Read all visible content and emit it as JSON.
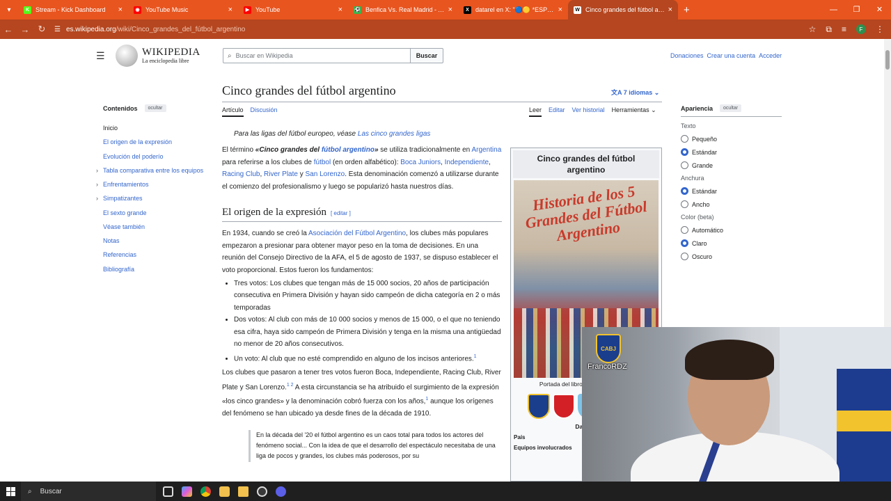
{
  "browser": {
    "tabs": [
      {
        "title": "Stream - Kick Dashboard",
        "color": "#53fc18",
        "glyph": "K"
      },
      {
        "title": "YouTube Music",
        "color": "#ff0000",
        "glyph": "◉"
      },
      {
        "title": "YouTube",
        "color": "#ff0000",
        "glyph": "▶"
      },
      {
        "title": "Benfica Vs. Real Madrid - Alinea",
        "color": "#39b54a",
        "glyph": "⚽"
      },
      {
        "title": "datarel en X: \"🔵🟡 *ESPERAN",
        "color": "#000000",
        "glyph": "X"
      },
      {
        "title": "Cinco grandes del fútbol argentin",
        "color": "#ffffff",
        "glyph": "W"
      }
    ],
    "new_tab": "+",
    "url_domain": "es.wikipedia.org",
    "url_path": "/wiki/Cinco_grandes_del_fútbol_argentino",
    "profile_initial": "F"
  },
  "wiki": {
    "logo_title": "WIKIPEDIA",
    "logo_subtitle": "La enciclopedia libre",
    "search_placeholder": "Buscar en Wikipedia",
    "search_button": "Buscar",
    "top_links": [
      "Donaciones",
      "Crear una cuenta",
      "Acceder"
    ],
    "article_title": "Cinco grandes del fútbol argentino",
    "languages": "7 idiomas",
    "tabs_left": [
      "Artículo",
      "Discusión"
    ],
    "tabs_right": [
      "Leer",
      "Editar",
      "Ver historial",
      "Herramientas"
    ],
    "toc": {
      "heading": "Contenidos",
      "hide": "ocultar",
      "items": [
        "Inicio",
        "El origen de la expresión",
        "Evolución del poderío",
        "Tabla comparativa entre los equipos",
        "Enfrentamientos",
        "Simpatizantes",
        "El sexto grande",
        "Véase también",
        "Notas",
        "Referencias",
        "Bibliografía"
      ]
    },
    "appearance": {
      "heading": "Apariencia",
      "hide": "ocultar",
      "text_label": "Texto",
      "text_options": [
        "Pequeño",
        "Estándar",
        "Grande"
      ],
      "width_label": "Anchura",
      "width_options": [
        "Estándar",
        "Ancho"
      ],
      "color_label": "Color (beta)",
      "color_options": [
        "Automático",
        "Claro",
        "Oscuro"
      ]
    },
    "hatnote_pre": "Para las ligas del fútbol europeo, véase ",
    "hatnote_link": "Las cinco grandes ligas",
    "intro": {
      "p1": "El término ",
      "bold1": "«Cinco grandes del ",
      "boldlink": "fútbol argentino",
      "bold2": "»",
      "p2": " se utiliza tradicionalmente en ",
      "l_arg": "Argentina",
      "p3": " para referirse a los clubes de ",
      "l_fut": "fútbol",
      "p4": " (en orden alfabético): ",
      "l_boca": "Boca Juniors",
      "l_ind": "Independiente",
      "l_rac": "Racing Club",
      "l_riv": "River Plate",
      "p5": " y ",
      "l_san": "San Lorenzo",
      "p6": ". Esta denominación comenzó a utilizarse durante el comienzo del profesionalismo y luego se popularizó hasta nuestros días."
    },
    "section_title": "El origen de la expresión",
    "edit_label": "[ editar ]",
    "sec_p1a": "En 1934, cuando se creó la ",
    "sec_link": "Asociación del Fútbol Argentino",
    "sec_p1b": ", los clubes más populares empezaron a presionar para obtener mayor peso en la toma de decisiones. En una reunión del Consejo Directivo de la AFA, el 5 de agosto de 1937, se dispuso establecer el voto proporcional. Estos fueron los fundamentos:",
    "bullets": [
      "Tres votos: Los clubes que tengan más de 15 000 socios, 20 años de participación consecutiva en Primera División y hayan sido campeón de dicha categoría en 2 o más temporadas",
      "Dos votos: Al club con más de 10 000 socios y menos de 15 000, o el que no teniendo esa cifra, haya sido campeón de Primera División y tenga en la misma una antigüedad no menor de 20 años consecutivos.",
      "Un voto: Al club que no esté comprendido en alguno de los incisos anteriores."
    ],
    "bullet_ref": "1",
    "p3a": "Los clubes que pasaron a tener tres votos fueron Boca, Independiente, Racing Club, River Plate y San Lorenzo.",
    "p3ref": "1 2",
    "p3b": " A esta circunstancia se ha atribuido el surgimiento de la expresión «los cinco grandes» y la denominación cobró fuerza con los años,",
    "p3ref2": "1",
    "p3c": " aunque los orígenes del fenómeno se han ubicado ya desde fines de la década de 1910.",
    "quote": "En la década del '20 el fútbol argentino es un caos total para todos los actores del fenómeno social... Con la idea de que el desarrollo del espectáculo necesitaba de una liga de pocos y grandes, los clubes más poderosos, por su",
    "infobox": {
      "title": "Cinco grandes del fútbol argentino",
      "poster_text": "Historia de los 5 Grandes del Fútbol Argentino",
      "caption": "Portada del libro Historia Fútbol Arg",
      "datos": "Datos g",
      "row1": "País",
      "row2": "Equipos involucrados"
    }
  },
  "webcam": {
    "badge": "CABJ",
    "name": "FrancoRDZ"
  },
  "taskbar": {
    "search": "Buscar"
  }
}
